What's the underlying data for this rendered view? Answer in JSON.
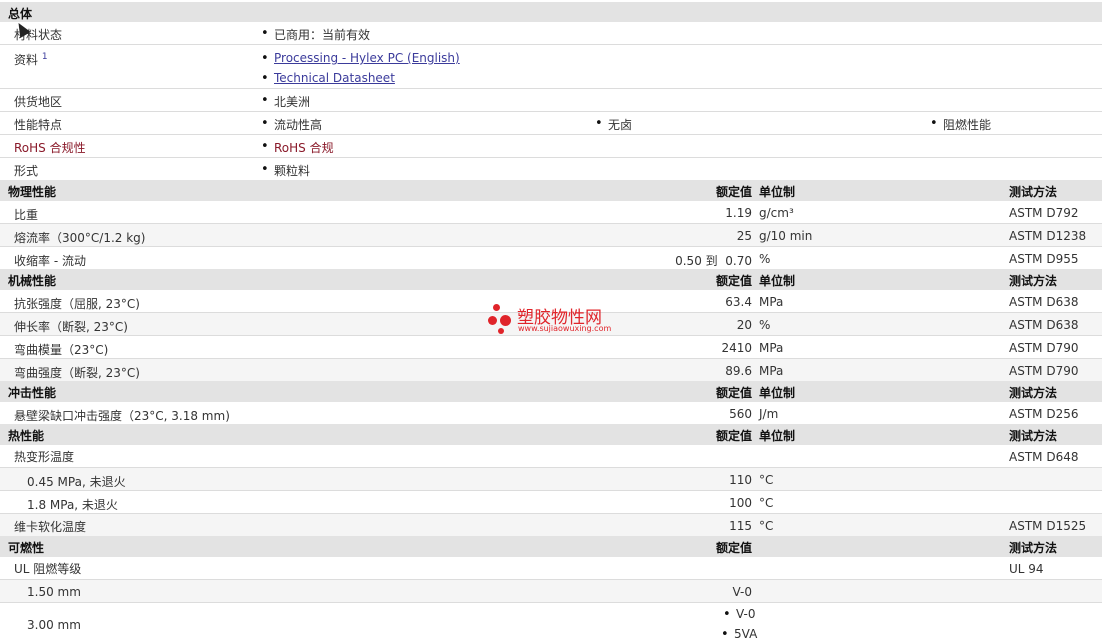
{
  "general": {
    "header": "总体",
    "rows": [
      {
        "label": "材料状态",
        "value": "已商用：当前有效"
      },
      {
        "label": "资料",
        "sup": "1",
        "links": [
          "Processing - Hylex PC (English)",
          "Technical Datasheet"
        ]
      },
      {
        "label": "供货地区",
        "value": "北美洲"
      },
      {
        "label": "性能特点",
        "values": [
          "流动性高",
          "无卤",
          "阻燃性能"
        ]
      },
      {
        "label": "RoHS 合规性",
        "value": "RoHS 合规"
      },
      {
        "label": "形式",
        "value": "颗粒料"
      }
    ]
  },
  "columns": {
    "nominal": "额定值",
    "unit": "单位制",
    "method": "测试方法"
  },
  "physical": {
    "header": "物理性能",
    "rows": [
      {
        "label": "比重",
        "value": "1.19",
        "unit": "g/cm³",
        "method": "ASTM D792"
      },
      {
        "label": "熔流率（300°C/1.2 kg)",
        "value": "25",
        "unit": "g/10 min",
        "method": "ASTM D1238"
      },
      {
        "label": "收缩率 - 流动",
        "value": "0.50 到  0.70",
        "unit": "%",
        "method": "ASTM D955"
      }
    ]
  },
  "mechanical": {
    "header": "机械性能",
    "rows": [
      {
        "label": "抗张强度（屈服, 23°C)",
        "value": "63.4",
        "unit": "MPa",
        "method": "ASTM D638"
      },
      {
        "label": "伸长率（断裂, 23°C)",
        "value": "20",
        "unit": "%",
        "method": "ASTM D638"
      },
      {
        "label": "弯曲模量（23°C)",
        "value": "2410",
        "unit": "MPa",
        "method": "ASTM D790"
      },
      {
        "label": "弯曲强度（断裂, 23°C)",
        "value": "89.6",
        "unit": "MPa",
        "method": "ASTM D790"
      }
    ]
  },
  "impact": {
    "header": "冲击性能",
    "rows": [
      {
        "label": "悬壁梁缺口冲击强度（23°C, 3.18 mm)",
        "value": "560",
        "unit": "J/m",
        "method": "ASTM D256"
      }
    ]
  },
  "thermal": {
    "header": "热性能",
    "rows": [
      {
        "label": "热变形温度",
        "method": "ASTM D648"
      },
      {
        "label": "0.45 MPa, 未退火",
        "value": "110",
        "unit": "°C"
      },
      {
        "label": "1.8 MPa, 未退火",
        "value": "100",
        "unit": "°C"
      },
      {
        "label": "维卡软化温度",
        "value": "115",
        "unit": "°C",
        "method": "ASTM D1525"
      }
    ]
  },
  "flammability": {
    "header": "可燃性",
    "rows": [
      {
        "label": "UL 阻燃等级",
        "method": "UL 94"
      },
      {
        "label": "1.50 mm",
        "value": "V-0"
      },
      {
        "label": "3.00 mm",
        "values": [
          "V-0",
          "5VA"
        ]
      }
    ]
  },
  "watermark": {
    "title": "塑胶物性网",
    "url": "www.sujiaowuxing.com"
  }
}
